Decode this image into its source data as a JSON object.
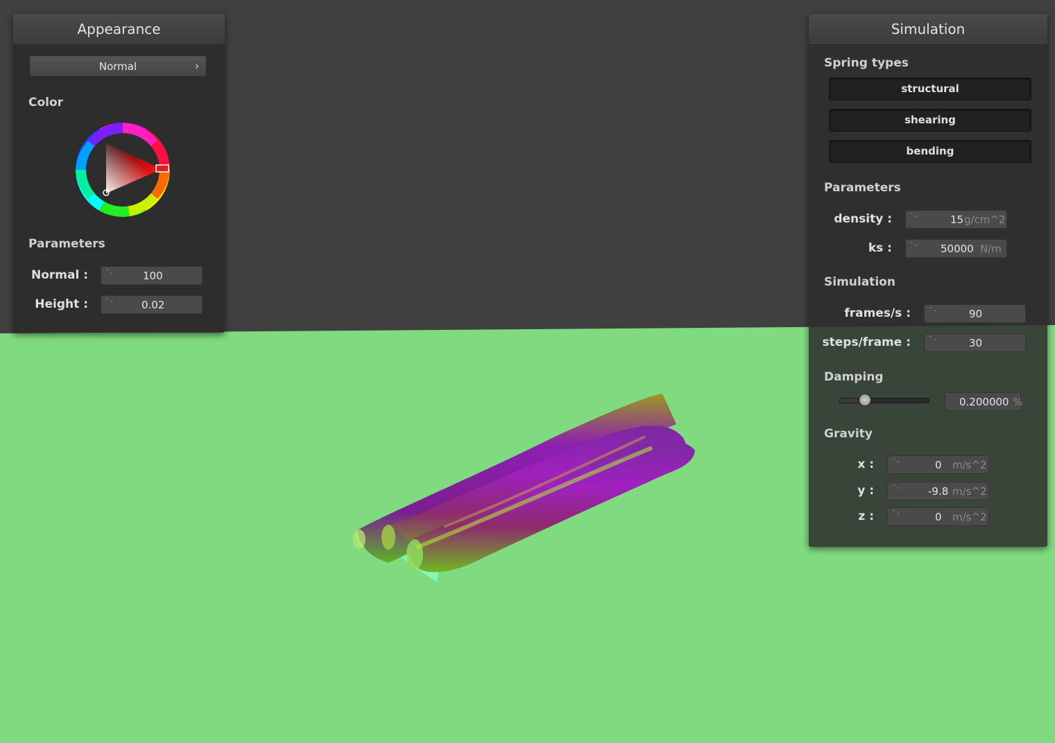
{
  "colors": {
    "background": "#404040",
    "floor": "#80db80",
    "panel": "#2c2c2c"
  },
  "appearance": {
    "title": "Appearance",
    "shader_button": {
      "label": "Normal",
      "icon": "chevron-right-icon",
      "chevron": "›"
    },
    "color_label": "Color",
    "color_wheel": {
      "selected_color": "#ff0000"
    },
    "parameters_label": "Parameters",
    "normal": {
      "label": "Normal :",
      "value": "100"
    },
    "height": {
      "label": "Height :",
      "value": "0.02"
    }
  },
  "simulation": {
    "title": "Simulation",
    "spring_types_label": "Spring types",
    "spring_types": [
      "structural",
      "shearing",
      "bending"
    ],
    "parameters_label": "Parameters",
    "density": {
      "label": "density :",
      "value": "15",
      "unit": "g/cm^2"
    },
    "ks": {
      "label": "ks :",
      "value": "50000",
      "unit": "N/m"
    },
    "simulation_label": "Simulation",
    "frames": {
      "label": "frames/s :",
      "value": "90"
    },
    "steps": {
      "label": "steps/frame :",
      "value": "30"
    },
    "damping_label": "Damping",
    "damping": {
      "value": "0.200000",
      "unit": "%",
      "fraction": 0.2
    },
    "gravity_label": "Gravity",
    "gravity": [
      {
        "label": "x :",
        "value": "0",
        "unit": "m/s^2"
      },
      {
        "label": "y :",
        "value": "-9.8",
        "unit": "m/s^2"
      },
      {
        "label": "z :",
        "value": "0",
        "unit": "m/s^2"
      }
    ],
    "spinner_arrows": "⌃⌄"
  }
}
